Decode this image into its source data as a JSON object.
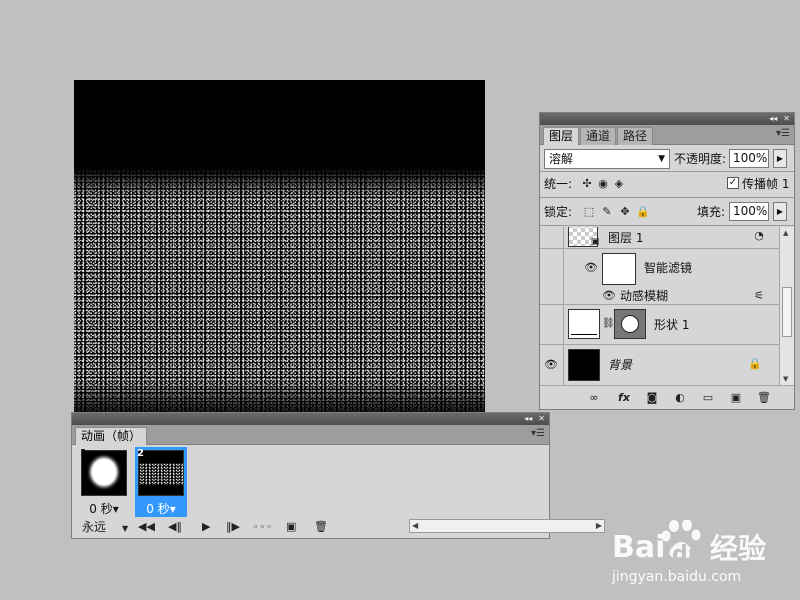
{
  "layers_panel": {
    "tabs": [
      "图层",
      "通道",
      "路径"
    ],
    "blend_mode": "溶解",
    "opacity_label": "不透明度:",
    "opacity_value": "100%",
    "unify_label": "统一:",
    "propagate_label": "传播帧 1",
    "lock_label": "锁定:",
    "fill_label": "填充:",
    "fill_value": "100%",
    "layers": [
      {
        "name": "图层 1",
        "visible": false
      },
      {
        "name": "智能滤镜",
        "visible": true
      },
      {
        "name": "动感模糊",
        "visible": true
      },
      {
        "name": "形状 1",
        "visible": false
      },
      {
        "name": "背景",
        "visible": true,
        "locked": true
      }
    ],
    "bottom_icons": [
      "link-icon",
      "fx-icon",
      "mask-icon",
      "adjustment-icon",
      "group-folder-icon",
      "new-layer-icon",
      "trash-icon"
    ]
  },
  "animation_panel": {
    "tab": "动画（帧）",
    "frames": [
      {
        "number": "1",
        "delay": "0 秒▾",
        "selected": false
      },
      {
        "number": "2",
        "delay": "0 秒▾",
        "selected": true
      }
    ],
    "loop_option": "永远"
  },
  "watermark": {
    "brand": "Bai",
    "brand2": "du",
    "product": "经验",
    "url": "jingyan.baidu.com"
  },
  "colors": {
    "workspace": "#c0c0c0",
    "panel": "#d6d6d6",
    "selection": "#3399ff"
  }
}
